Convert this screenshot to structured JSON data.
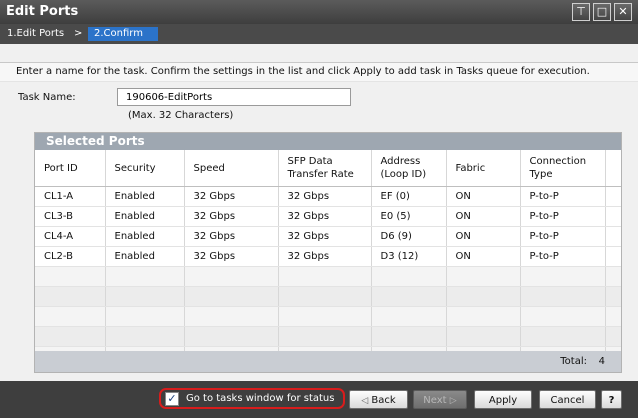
{
  "window": {
    "title": "Edit Ports"
  },
  "window_buttons": [
    "pin-icon",
    "maximize-icon",
    "close-icon"
  ],
  "breadcrumb": {
    "step1": "1.Edit Ports",
    "separator": ">",
    "step2": "2.Confirm"
  },
  "instructions": "Enter a name for the task. Confirm the settings in the list and click Apply to add task in Tasks queue for execution.",
  "task": {
    "label": "Task Name:",
    "value": "190606-EditPorts",
    "hint": "(Max. 32 Characters)"
  },
  "table": {
    "title": "Selected Ports",
    "columns": [
      "Port ID",
      "Security",
      "Speed",
      "SFP Data Transfer Rate",
      "Address (Loop ID)",
      "Fabric",
      "Connection Type"
    ],
    "rows": [
      [
        "CL1-A",
        "Enabled",
        "32 Gbps",
        "32 Gbps",
        "EF (0)",
        "ON",
        "P-to-P"
      ],
      [
        "CL3-B",
        "Enabled",
        "32 Gbps",
        "32 Gbps",
        "E0 (5)",
        "ON",
        "P-to-P"
      ],
      [
        "CL4-A",
        "Enabled",
        "32 Gbps",
        "32 Gbps",
        "D6 (9)",
        "ON",
        "P-to-P"
      ],
      [
        "CL2-B",
        "Enabled",
        "32 Gbps",
        "32 Gbps",
        "D3 (12)",
        "ON",
        "P-to-P"
      ]
    ],
    "total_label": "Total:",
    "total_value": "4"
  },
  "footer": {
    "goto_label": "Go to tasks window for status",
    "goto_checked": true,
    "back": "Back",
    "next": "Next",
    "apply": "Apply",
    "cancel": "Cancel",
    "help": "?"
  }
}
